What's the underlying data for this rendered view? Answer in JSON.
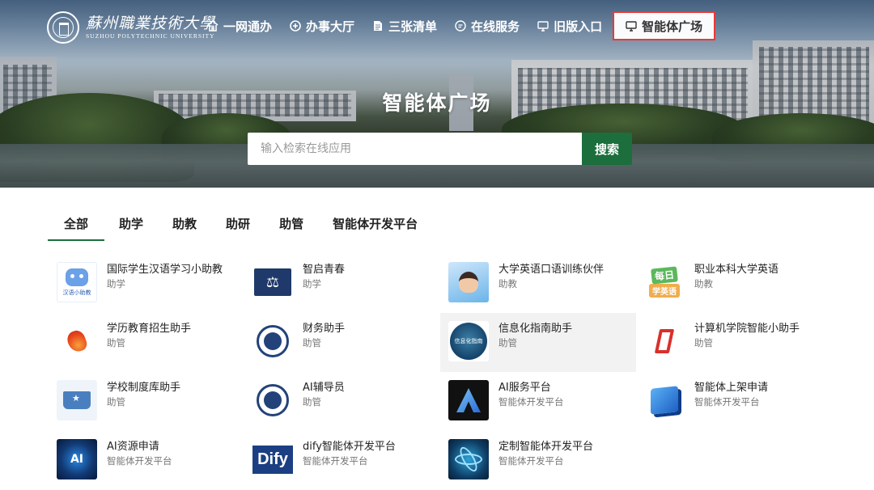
{
  "header": {
    "logo_cn": "蘇州職業技術大學",
    "logo_en": "SUZHOU POLYTECHNIC UNIVERSITY",
    "nav": [
      {
        "label": "一网通办",
        "icon": "home-icon"
      },
      {
        "label": "办事大厅",
        "icon": "hall-icon"
      },
      {
        "label": "三张清单",
        "icon": "document-icon"
      },
      {
        "label": "在线服务",
        "icon": "service-icon"
      },
      {
        "label": "旧版入口",
        "icon": "monitor-icon"
      },
      {
        "label": "智能体广场",
        "icon": "monitor-icon",
        "active": true
      }
    ]
  },
  "hero": {
    "title": "智能体广场",
    "search_placeholder": "输入检索在线应用",
    "search_button": "搜索"
  },
  "tabs": [
    {
      "label": "全部",
      "active": true
    },
    {
      "label": "助学"
    },
    {
      "label": "助教"
    },
    {
      "label": "助研"
    },
    {
      "label": "助管"
    },
    {
      "label": "智能体开发平台"
    }
  ],
  "apps": [
    {
      "name": "国际学生汉语学习小助教",
      "category": "助学",
      "icon": "robot-icon",
      "thumb_text": "汉语小助教"
    },
    {
      "name": "智启青春",
      "category": "助学",
      "icon": "scale-icon"
    },
    {
      "name": "大学英语口语训练伙伴",
      "category": "助教",
      "icon": "speaker-avatar-icon"
    },
    {
      "name": "职业本科大学英语",
      "category": "助教",
      "icon": "daily-english-icon",
      "thumb_text": "每日",
      "thumb_text2": "学英语"
    },
    {
      "name": "学历教育招生助手",
      "category": "助管",
      "icon": "flame-logo-icon"
    },
    {
      "name": "财务助手",
      "category": "助管",
      "icon": "finance-seal-icon"
    },
    {
      "name": "信息化指南助手",
      "category": "助管",
      "icon": "info-guide-icon",
      "thumb_text": "信息化指南",
      "hover": true
    },
    {
      "name": "计算机学院智能小助手",
      "category": "助管",
      "icon": "cs-college-icon"
    },
    {
      "name": "学校制度库助手",
      "category": "助管",
      "icon": "book-icon"
    },
    {
      "name": "AI辅导员",
      "category": "助管",
      "icon": "university-seal-icon"
    },
    {
      "name": "AI服务平台",
      "category": "智能体开发平台",
      "icon": "ai-logo-icon"
    },
    {
      "name": "智能体上架申请",
      "category": "智能体开发平台",
      "icon": "cube-icon"
    },
    {
      "name": "AI资源申请",
      "category": "智能体开发平台",
      "icon": "ai-chip-icon",
      "thumb_text": "AI"
    },
    {
      "name": "dify智能体开发平台",
      "category": "智能体开发平台",
      "icon": "dify-logo-icon",
      "thumb_text": "Dify"
    },
    {
      "name": "定制智能体开发平台",
      "category": "智能体开发平台",
      "icon": "atom-icon"
    }
  ]
}
